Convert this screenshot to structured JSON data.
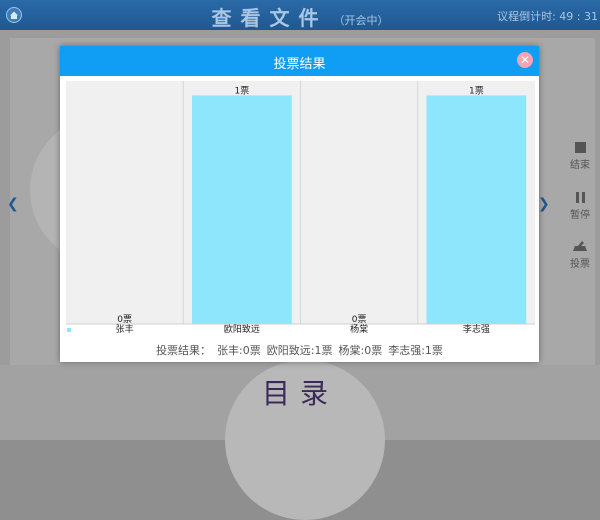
{
  "header": {
    "title": "查看文件",
    "status": "（开会中）",
    "countdown": "议程倒计时: 49 : 31"
  },
  "side_tools": [
    {
      "label": "结束",
      "icon": "stop-icon"
    },
    {
      "label": "暂停",
      "icon": "pause-icon"
    },
    {
      "label": "投票",
      "icon": "vote-icon"
    }
  ],
  "bottom_title": "目录",
  "dialog": {
    "title": "投票结果",
    "summary_prefix": "投票结果：",
    "summary_items": [
      "张丰:0票",
      "欧阳致远:1票",
      "杨棠:0票",
      "李志强:1票"
    ]
  },
  "colors": {
    "accent": "#0f9ef4",
    "bar": "#8de6fb",
    "plot_bg": "#f0f0f0"
  },
  "chart_data": {
    "type": "bar",
    "categories": [
      "张丰",
      "欧阳致远",
      "杨棠",
      "李志强"
    ],
    "values": [
      0,
      1,
      0,
      1
    ],
    "data_labels": [
      "0票",
      "1票",
      "0票",
      "1票"
    ],
    "ylim": [
      0,
      1.05
    ],
    "grid": false,
    "legend": "bottom-left"
  }
}
